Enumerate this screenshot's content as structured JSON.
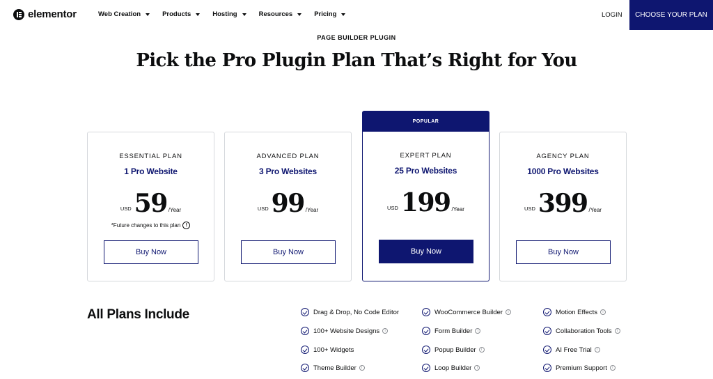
{
  "nav": {
    "logo_text": "elementor",
    "menu": [
      "Web Creation",
      "Products",
      "Hosting",
      "Resources",
      "Pricing"
    ],
    "login": "LOGIN",
    "cta": "CHOOSE YOUR PLAN"
  },
  "header": {
    "eyebrow": "PAGE BUILDER PLUGIN",
    "title": "Pick the Pro Plugin Plan That’s Right for You"
  },
  "popular_label": "POPULAR",
  "plans": [
    {
      "name": "ESSENTIAL PLAN",
      "sites": "1 Pro Website",
      "currency": "USD",
      "price": "59",
      "period": "/Year",
      "note": "*Future changes to this plan",
      "cta": "Buy Now"
    },
    {
      "name": "ADVANCED PLAN",
      "sites": "3 Pro Websites",
      "currency": "USD",
      "price": "99",
      "period": "/Year",
      "cta": "Buy Now"
    },
    {
      "name": "EXPERT PLAN",
      "sites": "25 Pro Websites",
      "currency": "USD",
      "price": "199",
      "period": "/Year",
      "cta": "Buy Now"
    },
    {
      "name": "AGENCY PLAN",
      "sites": "1000 Pro Websites",
      "currency": "USD",
      "price": "399",
      "period": "/Year",
      "cta": "Buy Now"
    }
  ],
  "includes": {
    "title": "All Plans Include",
    "features": [
      {
        "label": "Drag & Drop, No Code Editor",
        "info": false
      },
      {
        "label": "100+ Website Designs",
        "info": true
      },
      {
        "label": "100+ Widgets",
        "info": false
      },
      {
        "label": "Theme Builder",
        "info": true
      },
      {
        "label": "WooCommerce Builder",
        "info": true
      },
      {
        "label": "Form Builder",
        "info": true
      },
      {
        "label": "Popup Builder",
        "info": true
      },
      {
        "label": "Loop Builder",
        "info": true
      },
      {
        "label": "Motion Effects",
        "info": true
      },
      {
        "label": "Collaboration Tools",
        "info": true
      },
      {
        "label": "AI Free Trial",
        "info": true
      },
      {
        "label": "Premium Support",
        "info": true
      }
    ]
  },
  "colors": {
    "brand": "#0e1670",
    "text": "#0c0d0e",
    "border": "#d5d8dc"
  }
}
